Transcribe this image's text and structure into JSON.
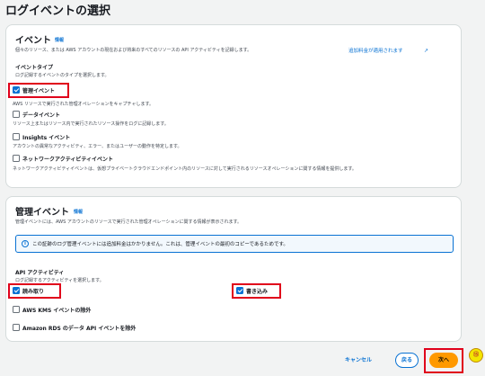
{
  "page": {
    "title": "ログイベントの選択"
  },
  "events_panel": {
    "title": "イベント",
    "info": "情報",
    "description": "個々のリソース、または AWS アカウントの現在および将来のすべてのリソースの API アクティビティを記録します。",
    "pricing_link": "追加料金が適用されます",
    "event_type_label": "イベントタイプ",
    "event_type_desc": "ログ記録するイベントのタイプを選択します。",
    "options": [
      {
        "label": "管理イベント",
        "desc": "AWS リソースで実行された管理オペレーションをキャプチャします。",
        "checked": true
      },
      {
        "label": "データイベント",
        "desc": "リソース上またはリソース内で実行されたリソース操作をログに記録します。",
        "checked": false
      },
      {
        "label": "Insights イベント",
        "desc": "アカウントの異常なアクティビティ、エラー、またはユーザーの動作を特定します。",
        "checked": false
      },
      {
        "label": "ネットワークアクティビティイベント",
        "desc": "ネットワークアクティビティイベントは、仮想プライベートクラウドエンドポイント内のリソースに対して実行されるリソースオペレーションに関する情報を提供します。",
        "checked": false
      }
    ]
  },
  "mgmt_panel": {
    "title": "管理イベント",
    "info": "情報",
    "description": "管理イベントには、AWS アカウントのリソースで実行された管理オペレーションに関する情報が表示されます。",
    "alert": "この証跡のログ管理イベントには追加料金はかかりません。これは、管理イベントの最初のコピーであるためです。",
    "api_label": "API アクティビティ",
    "api_desc": "ログ記録するアクティビティを選択します。",
    "read_label": "読み取り",
    "read_checked": true,
    "write_label": "書き込み",
    "write_checked": true,
    "kms_label": "AWS KMS イベントの除外",
    "rds_label": "Amazon RDS のデータ API イベントを除外"
  },
  "footer": {
    "cancel": "キャンセル",
    "back": "戻る",
    "next": "次へ",
    "step_badge": "⑮"
  },
  "colors": {
    "accent": "#0972d3",
    "primary_button": "#ff9900",
    "highlight_border": "#e0001b"
  },
  "icons": {
    "external": "external-link-icon",
    "info": "info-circle-icon",
    "check": "checkmark-icon"
  }
}
